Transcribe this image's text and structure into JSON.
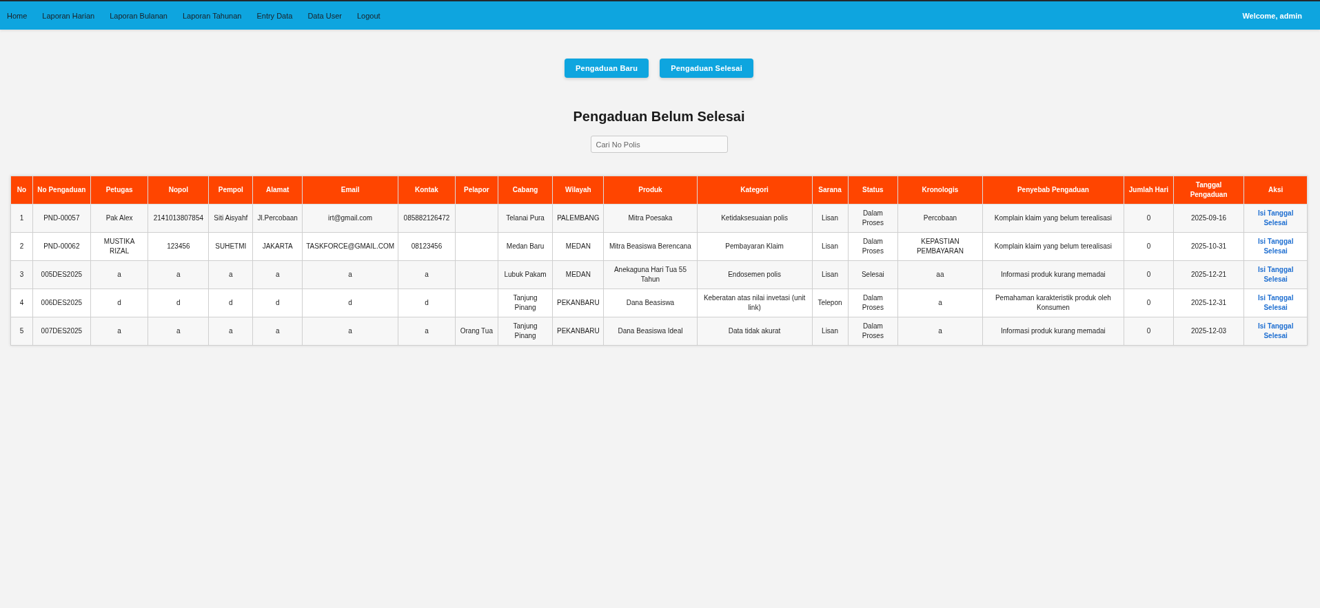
{
  "nav": {
    "items": [
      {
        "label": "Home"
      },
      {
        "label": "Laporan Harian"
      },
      {
        "label": "Laporan Bulanan"
      },
      {
        "label": "Laporan Tahunan"
      },
      {
        "label": "Entry Data"
      },
      {
        "label": "Data User"
      },
      {
        "label": "Logout"
      }
    ],
    "welcome": "Welcome, admin"
  },
  "actions": [
    {
      "label": "Pengaduan Baru"
    },
    {
      "label": "Pengaduan Selesai"
    }
  ],
  "heading": "Pengaduan Belum Selesai",
  "search": {
    "placeholder": "Cari No Polis"
  },
  "table": {
    "columns": [
      "No",
      "No Pengaduan",
      "Petugas",
      "Nopol",
      "Pempol",
      "Alamat",
      "Email",
      "Kontak",
      "Pelapor",
      "Cabang",
      "Wilayah",
      "Produk",
      "Kategori",
      "Sarana",
      "Status",
      "Kronologis",
      "Penyebab Pengaduan",
      "Jumlah Hari",
      "Tanggal Pengaduan",
      "Aksi"
    ],
    "rows": [
      {
        "cells": [
          "1",
          "PND-00057",
          "Pak Alex",
          "2141013807854",
          "Siti Aisyahf",
          "Jl.Percobaan",
          "irt@gmail.com",
          "085882126472",
          null,
          "Telanai Pura",
          "PALEMBANG",
          "Mitra Poesaka",
          "Ketidaksesuaian polis",
          "Lisan",
          "Dalam Proses",
          "Percobaan",
          "Komplain klaim yang belum terealisasi",
          "0",
          "2025-09-16"
        ],
        "action": "Isi Tanggal Selesai"
      },
      {
        "cells": [
          "2",
          "PND-00062",
          "MUSTIKA RIZAL",
          "123456",
          "SUHETMI",
          "JAKARTA",
          "TASKFORCE@GMAIL.COM",
          "08123456",
          null,
          "Medan Baru",
          "MEDAN",
          "Mitra Beasiswa Berencana",
          "Pembayaran Klaim",
          "Lisan",
          "Dalam Proses",
          "KEPASTIAN PEMBAYARAN",
          "Komplain klaim yang belum terealisasi",
          "0",
          "2025-10-31"
        ],
        "action": "Isi Tanggal Selesai"
      },
      {
        "cells": [
          "3",
          "005DES2025",
          "a",
          "a",
          "a",
          "a",
          "a",
          "a",
          null,
          "Lubuk Pakam",
          "MEDAN",
          "Anekaguna Hari Tua 55 Tahun",
          "Endosemen polis",
          "Lisan",
          "Selesai",
          "aa",
          "Informasi produk kurang memadai",
          "0",
          "2025-12-21"
        ],
        "action": "Isi Tanggal Selesai"
      },
      {
        "cells": [
          "4",
          "006DES2025",
          "d",
          "d",
          "d",
          "d",
          "d",
          "d",
          null,
          "Tanjung Pinang",
          "PEKANBARU",
          "Dana Beasiswa",
          "Keberatan atas nilai invetasi (unit link)",
          "Telepon",
          "Dalam Proses",
          "a",
          "Pemahaman karakteristik produk oleh Konsumen",
          "0",
          "2025-12-31"
        ],
        "action": "Isi Tanggal Selesai"
      },
      {
        "cells": [
          "5",
          "007DES2025",
          "a",
          "a",
          "a",
          "a",
          "a",
          "a",
          "Orang Tua",
          "Tanjung Pinang",
          "PEKANBARU",
          "Dana Beasiswa Ideal",
          "Data tidak akurat",
          "Lisan",
          "Dalam Proses",
          "a",
          "Informasi produk kurang memadai",
          "0",
          "2025-12-03"
        ],
        "action": "Isi Tanggal Selesai"
      }
    ]
  }
}
